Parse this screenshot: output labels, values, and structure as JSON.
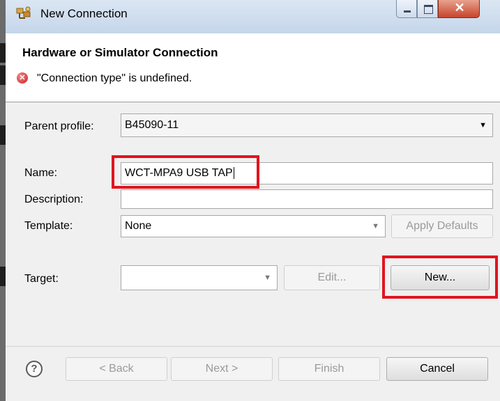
{
  "window": {
    "title": "New Connection"
  },
  "header": {
    "title": "Hardware or Simulator Connection",
    "error_message": "\"Connection type\" is undefined."
  },
  "form": {
    "parent_profile": {
      "label": "Parent profile:",
      "value": "B45090-11"
    },
    "name": {
      "label": "Name:",
      "value": "WCT-MPA9 USB TAP"
    },
    "description": {
      "label": "Description:",
      "value": ""
    },
    "template": {
      "label": "Template:",
      "value": "None",
      "apply_defaults_label": "Apply Defaults"
    },
    "target": {
      "label": "Target:",
      "value": "",
      "edit_label": "Edit...",
      "new_label": "New..."
    }
  },
  "footer": {
    "back_label": "< Back",
    "next_label": "Next >",
    "finish_label": "Finish",
    "cancel_label": "Cancel"
  },
  "icons": {
    "error": "error-icon",
    "help": "help-icon",
    "app": "connection-icon"
  },
  "colors": {
    "highlight_box": "#e0141f",
    "error_icon": "#c81e1e"
  }
}
